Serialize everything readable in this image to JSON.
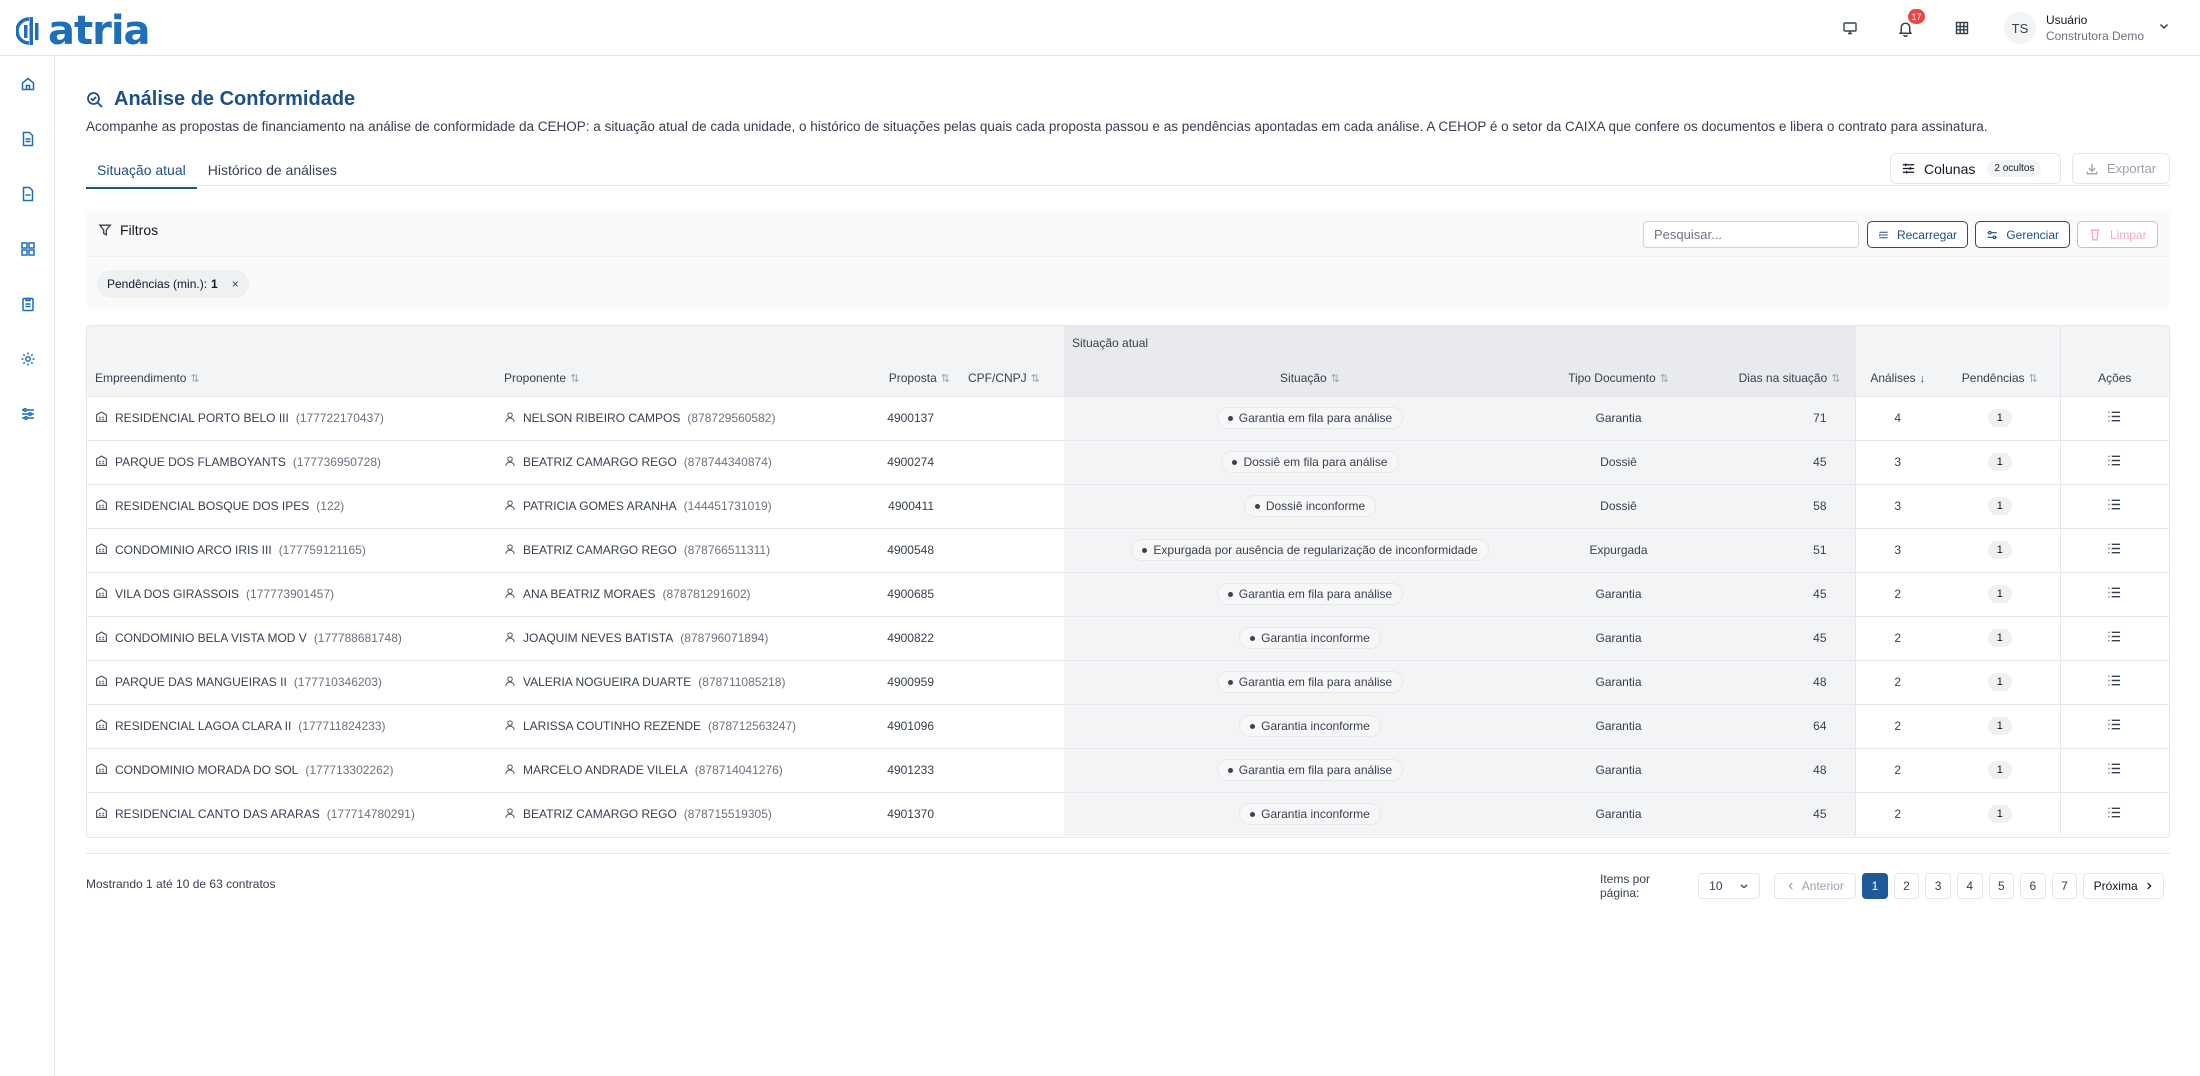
{
  "brand": {
    "name": "atria",
    "color": "#1e6fb8"
  },
  "topbar": {
    "notifications_count": "17",
    "user": {
      "initials": "TS",
      "name": "Usuário",
      "company": "Construtora Demo"
    },
    "icons": [
      "monitor-icon",
      "bell-icon",
      "building-icon",
      "chevron-down-icon"
    ]
  },
  "sidebar": {
    "items": [
      {
        "icon": "home-icon"
      },
      {
        "icon": "file-text-icon"
      },
      {
        "icon": "file-icon"
      },
      {
        "icon": "dashboard-icon"
      },
      {
        "icon": "clipboard-icon"
      },
      {
        "icon": "gear-icon"
      },
      {
        "icon": "sliders-icon"
      }
    ]
  },
  "page": {
    "title": "Análise de Conformidade",
    "description": "Acompanhe as propostas de financiamento na análise de conformidade da CEHOP: a situação atual de cada unidade, o histórico de situações pelas quais cada proposta passou e as pendências apontadas em cada análise. A CEHOP é o setor da CAIXA que confere os documentos e libera o contrato para assinatura."
  },
  "tabs": [
    {
      "label": "Situação atual",
      "active": true
    },
    {
      "label": "Histórico de análises",
      "active": false
    }
  ],
  "toolbar": {
    "columns_label": "Colunas",
    "hidden_label": "2 ocultos",
    "export_label": "Exportar"
  },
  "filters": {
    "title": "Filtros",
    "search_placeholder": "Pesquisar...",
    "reload_label": "Recarregar",
    "manage_label": "Gerenciar",
    "clear_label": "Limpar",
    "chip": {
      "label": "Pendências (min.):",
      "value": "1",
      "remove": "×"
    }
  },
  "table": {
    "group_header": "Situação atual",
    "columns": {
      "empreendimento": "Empreendimento",
      "proponente": "Proponente",
      "proposta": "Proposta",
      "cpf": "CPF/CNPJ",
      "situacao": "Situação",
      "tipo": "Tipo Documento",
      "dias": "Dias na situação",
      "analises": "Análises",
      "pendencias": "Pendências",
      "acoes": "Ações"
    },
    "rows": [
      {
        "emp": "RESIDENCIAL PORTO BELO III",
        "emp_code": "(177722170437)",
        "prop": "NELSON RIBEIRO CAMPOS",
        "prop_code": "(878729560582)",
        "proposta": "4900137",
        "situacao": "Garantia em fila para análise",
        "tipo": "Garantia",
        "dias": "71",
        "analises": "4",
        "pendencias": "1"
      },
      {
        "emp": "PARQUE DOS FLAMBOYANTS",
        "emp_code": "(177736950728)",
        "prop": "BEATRIZ CAMARGO REGO",
        "prop_code": "(878744340874)",
        "proposta": "4900274",
        "situacao": "Dossiê em fila para análise",
        "tipo": "Dossiê",
        "dias": "45",
        "analises": "3",
        "pendencias": "1"
      },
      {
        "emp": "RESIDENCIAL BOSQUE DOS IPES",
        "emp_code": "(122)",
        "prop": "PATRICIA GOMES ARANHA",
        "prop_code": "(144451731019)",
        "proposta": "4900411",
        "situacao": "Dossiê inconforme",
        "tipo": "Dossiê",
        "dias": "58",
        "analises": "3",
        "pendencias": "1"
      },
      {
        "emp": "CONDOMINIO ARCO IRIS III",
        "emp_code": "(177759121165)",
        "prop": "BEATRIZ CAMARGO REGO",
        "prop_code": "(878766511311)",
        "proposta": "4900548",
        "situacao": "Expurgada por ausência de regularização de inconformidade",
        "tipo": "Expurgada",
        "dias": "51",
        "analises": "3",
        "pendencias": "1"
      },
      {
        "emp": "VILA DOS GIRASSOIS",
        "emp_code": "(177773901457)",
        "prop": "ANA BEATRIZ MORAES",
        "prop_code": "(878781291602)",
        "proposta": "4900685",
        "situacao": "Garantia em fila para análise",
        "tipo": "Garantia",
        "dias": "45",
        "analises": "2",
        "pendencias": "1"
      },
      {
        "emp": "CONDOMINIO BELA VISTA MOD V",
        "emp_code": "(177788681748)",
        "prop": "JOAQUIM NEVES BATISTA",
        "prop_code": "(878796071894)",
        "proposta": "4900822",
        "situacao": "Garantia inconforme",
        "tipo": "Garantia",
        "dias": "45",
        "analises": "2",
        "pendencias": "1"
      },
      {
        "emp": "PARQUE DAS MANGUEIRAS II",
        "emp_code": "(177710346203)",
        "prop": "VALERIA NOGUEIRA DUARTE",
        "prop_code": "(878711085218)",
        "proposta": "4900959",
        "situacao": "Garantia em fila para análise",
        "tipo": "Garantia",
        "dias": "48",
        "analises": "2",
        "pendencias": "1"
      },
      {
        "emp": "RESIDENCIAL LAGOA CLARA II",
        "emp_code": "(177711824233)",
        "prop": "LARISSA COUTINHO REZENDE",
        "prop_code": "(878712563247)",
        "proposta": "4901096",
        "situacao": "Garantia inconforme",
        "tipo": "Garantia",
        "dias": "64",
        "analises": "2",
        "pendencias": "1"
      },
      {
        "emp": "CONDOMINIO MORADA DO SOL",
        "emp_code": "(177713302262)",
        "prop": "MARCELO ANDRADE VILELA",
        "prop_code": "(878714041276)",
        "proposta": "4901233",
        "situacao": "Garantia em fila para análise",
        "tipo": "Garantia",
        "dias": "48",
        "analises": "2",
        "pendencias": "1"
      },
      {
        "emp": "RESIDENCIAL CANTO DAS ARARAS",
        "emp_code": "(177714780291)",
        "prop": "BEATRIZ CAMARGO REGO",
        "prop_code": "(878715519305)",
        "proposta": "4901370",
        "situacao": "Garantia inconforme",
        "tipo": "Garantia",
        "dias": "45",
        "analises": "2",
        "pendencias": "1"
      }
    ]
  },
  "footer": {
    "info": "Mostrando 1 até 10 de 63 contratos",
    "per_page_label": "Items por página:",
    "per_page_value": "10",
    "prev_label": "Anterior",
    "next_label": "Próxima",
    "pages": [
      "1",
      "2",
      "3",
      "4",
      "5",
      "6",
      "7"
    ],
    "current_page": "1"
  }
}
